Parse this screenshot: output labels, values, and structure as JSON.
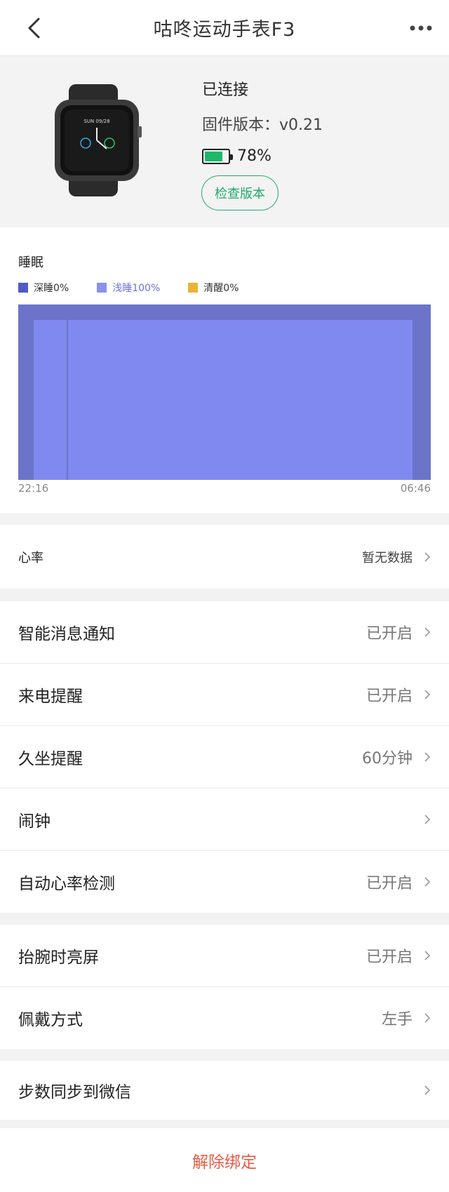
{
  "header": {
    "title": "咕咚运动手表F3"
  },
  "device": {
    "status": "已连接",
    "firmware": "固件版本：v0.21",
    "battery_text": "78%",
    "battery_level_percent": 78,
    "check_button": "检查版本",
    "watch_face_text": "SUN 09/28"
  },
  "sleep": {
    "title": "睡眠",
    "legend": [
      {
        "label": "深睡0%",
        "color": "#4f5ac7"
      },
      {
        "label": "浅睡100%",
        "color": "#8a91ee"
      },
      {
        "label": "清醒0%",
        "color": "#e9b33a"
      }
    ],
    "start_time": "22:16",
    "end_time": "06:46"
  },
  "heart_rate": {
    "label": "心率",
    "value": "暂无数据"
  },
  "settings_group1": [
    {
      "label": "智能消息通知",
      "value": "已开启"
    },
    {
      "label": "来电提醒",
      "value": "已开启"
    },
    {
      "label": "久坐提醒",
      "value": "60分钟"
    },
    {
      "label": "闹钟",
      "value": ""
    },
    {
      "label": "自动心率检测",
      "value": "已开启"
    }
  ],
  "settings_group2": [
    {
      "label": "抬腕时亮屏",
      "value": "已开启"
    },
    {
      "label": "佩戴方式",
      "value": "左手"
    }
  ],
  "wechat": {
    "label": "步数同步到微信"
  },
  "unbind": {
    "label": "解除绑定"
  },
  "colors": {
    "accent_green": "#1faa6b",
    "unbind_red": "#e85b46",
    "chart_dark": "#6b74c9",
    "chart_light": "#8089ef"
  },
  "icons": [
    "back-arrow-icon",
    "more-dots-icon",
    "battery-icon",
    "chevron-right-icon"
  ]
}
